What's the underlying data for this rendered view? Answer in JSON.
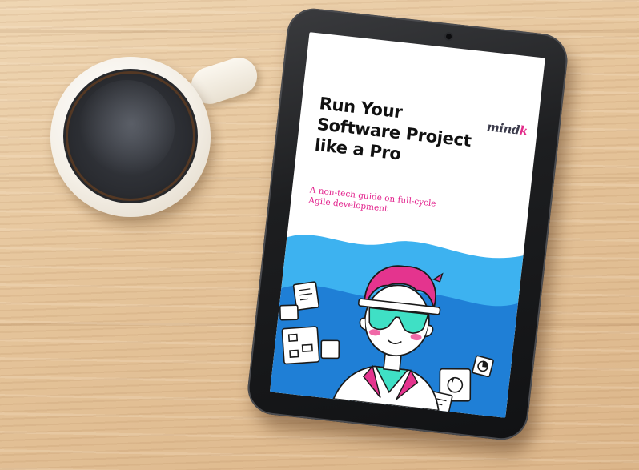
{
  "scene": {
    "description_colors": {
      "wood": "#e5c49a",
      "coffee": "#2a2c31",
      "mug": "#f4efe6",
      "tablet_bezel": "#1d1e20"
    }
  },
  "ebook": {
    "logo": {
      "text": "mind",
      "accent": "k"
    },
    "title_lines": [
      "Run Your",
      "Software Project",
      "like a Pro"
    ],
    "subtitle_lines": [
      "A non-tech guide on full-cycle",
      "Agile development"
    ],
    "colors": {
      "title": "#111111",
      "subtitle": "#e2218c",
      "wave_light": "#3db2f0",
      "wave_dark": "#1f7fd6",
      "hair": "#e4348e",
      "glasses": "#3fe0c5",
      "cheeks": "#f06aa8"
    }
  }
}
